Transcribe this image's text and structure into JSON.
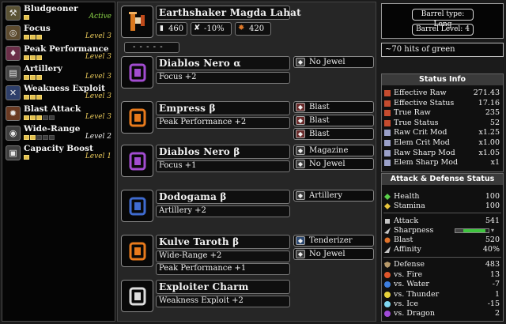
{
  "skills": [
    {
      "name": "Bludgeoner",
      "level": "Active",
      "pips_on": 1,
      "pips_total": 1,
      "icon": "hammer-icon",
      "level_style": "active"
    },
    {
      "name": "Focus",
      "level": "Level 3",
      "pips_on": 3,
      "pips_total": 3,
      "icon": "focus-icon",
      "level_style": "gold"
    },
    {
      "name": "Peak Performance",
      "level": "Level 3",
      "pips_on": 3,
      "pips_total": 3,
      "icon": "peak-icon",
      "level_style": "gold"
    },
    {
      "name": "Artillery",
      "level": "Level 3",
      "pips_on": 3,
      "pips_total": 3,
      "icon": "artillery-icon",
      "level_style": "gold"
    },
    {
      "name": "Weakness Exploit",
      "level": "Level 3",
      "pips_on": 3,
      "pips_total": 3,
      "icon": "weakness-icon",
      "level_style": "gold"
    },
    {
      "name": "Blast Attack",
      "level": "Level 3",
      "pips_on": 3,
      "pips_total": 5,
      "icon": "blast-icon",
      "level_style": "gold"
    },
    {
      "name": "Wide-Range",
      "level": "Level 2",
      "pips_on": 2,
      "pips_total": 5,
      "icon": "wide-range-icon",
      "level_style": "white"
    },
    {
      "name": "Capacity Boost",
      "level": "Level 1",
      "pips_on": 1,
      "pips_total": 1,
      "icon": "capacity-icon",
      "level_style": "gold"
    }
  ],
  "weapon": {
    "name": "Earthshaker Magda Lahat",
    "attack": "460",
    "affinity": "-10%",
    "element": "420",
    "slots": "- - - - -"
  },
  "armor": [
    {
      "name": "Diablos Nero α",
      "skills": [
        "Focus +2"
      ],
      "jewels": [
        "No Jewel"
      ],
      "jewel_colors": [
        "grey"
      ],
      "color": "#a24cd0"
    },
    {
      "name": "Empress β",
      "skills": [
        "Peak Performance +2"
      ],
      "jewels": [
        "Blast",
        "Blast",
        "Blast"
      ],
      "jewel_colors": [
        "red",
        "red",
        "red"
      ],
      "color": "#e87a1c"
    },
    {
      "name": "Diablos Nero β",
      "skills": [
        "Focus +1"
      ],
      "jewels": [
        "Magazine",
        "No Jewel"
      ],
      "jewel_colors": [
        "grey",
        "grey"
      ],
      "color": "#a24cd0"
    },
    {
      "name": "Dodogama β",
      "skills": [
        "Artillery +2"
      ],
      "jewels": [
        "Artillery"
      ],
      "jewel_colors": [
        "grey"
      ],
      "color": "#3f6bd0"
    },
    {
      "name": "Kulve Taroth β",
      "skills": [
        "Wide-Range +2",
        "Peak Performance +1"
      ],
      "jewels": [
        "Tenderizer",
        "No Jewel"
      ],
      "jewel_colors": [
        "blue",
        "grey"
      ],
      "color": "#e87a1c"
    },
    {
      "name": "Exploiter Charm",
      "skills": [
        "Weakness Exploit +2"
      ],
      "jewels": [],
      "jewel_colors": [],
      "color": "#dddddd"
    }
  ],
  "barrel": {
    "type": "Barrel type: Long",
    "level": "Barrel Level: 4"
  },
  "hits": "~70 hits of green",
  "status_info": {
    "title": "Status Info",
    "rows": [
      {
        "label": "Effective Raw",
        "value": "271.43",
        "color": "#c44b2e"
      },
      {
        "label": "Effective Status",
        "value": "17.16",
        "color": "#c44b2e"
      },
      {
        "label": "True Raw",
        "value": "235",
        "color": "#c44b2e"
      },
      {
        "label": "True Status",
        "value": "52",
        "color": "#c44b2e"
      },
      {
        "label": "Raw Crit Mod",
        "value": "x1.25",
        "color": "#9aa0c8"
      },
      {
        "label": "Elem Crit Mod",
        "value": "x1.00",
        "color": "#9aa0c8"
      },
      {
        "label": "Raw Sharp Mod",
        "value": "x1.05",
        "color": "#9aa0c8"
      },
      {
        "label": "Elem Sharp Mod",
        "value": "x1",
        "color": "#9aa0c8"
      }
    ]
  },
  "attack_defense": {
    "title": "Attack & Defense Status",
    "health": {
      "label": "Health",
      "value": "100"
    },
    "stamina": {
      "label": "Stamina",
      "value": "100"
    },
    "attack": {
      "label": "Attack",
      "value": "541"
    },
    "sharpness": {
      "label": "Sharpness"
    },
    "blast": {
      "label": "Blast",
      "value": "520"
    },
    "affinity": {
      "label": "Affinity",
      "value": "40%"
    },
    "defense": {
      "label": "Defense",
      "value": "483"
    },
    "resist": [
      {
        "label": "vs. Fire",
        "value": "13",
        "color": "#e0552a"
      },
      {
        "label": "vs. Water",
        "value": "-7",
        "color": "#3d7ee0"
      },
      {
        "label": "vs. Thunder",
        "value": "1",
        "color": "#e8d23a"
      },
      {
        "label": "vs. Ice",
        "value": "-15",
        "color": "#7fd8f0"
      },
      {
        "label": "vs. Dragon",
        "value": "2",
        "color": "#a04ad8"
      }
    ]
  }
}
